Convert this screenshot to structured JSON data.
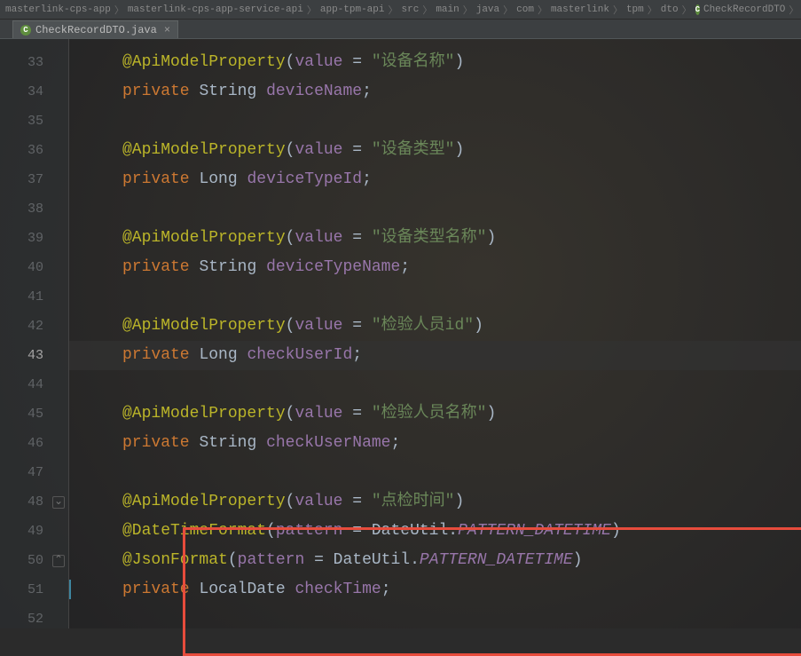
{
  "breadcrumb": {
    "items": [
      "masterlink-cps-app",
      "masterlink-cps-app-service-api",
      "app-tpm-api",
      "src",
      "main",
      "java",
      "com",
      "masterlink",
      "tpm",
      "dto"
    ],
    "class_name": "CheckRecordDTO",
    "field_prefix": "ch"
  },
  "tab": {
    "filename": "CheckRecordDTO.java",
    "close_glyph": "×"
  },
  "gutter": {
    "start": 33,
    "end": 52,
    "current": 43,
    "fold_open_line": 48,
    "fold_close_line": 50
  },
  "tokens": {
    "ann_api": "@ApiModelProperty",
    "ann_dtf": "@DateTimeFormat",
    "ann_json": "@JsonFormat",
    "value": "value",
    "pattern": "pattern",
    "eq": " = ",
    "private": "private",
    "String": "String",
    "Long": "Long",
    "LocalDate": "LocalDate",
    "DateUtil": "DateUtil",
    "PATTERN_DATETIME": "PATTERN_DATETIME",
    "semicolon": ";",
    "lparen": "(",
    "rparen": ")",
    "dot": "."
  },
  "strings": {
    "deviceName": "\"设备名称\"",
    "deviceType": "\"设备类型\"",
    "deviceTypeName": "\"设备类型名称\"",
    "checkUserId": "\"检验人员id\"",
    "checkUserName": "\"检验人员名称\"",
    "checkTime": "\"点检时间\""
  },
  "fields": {
    "deviceName": "deviceName",
    "deviceTypeId": "deviceTypeId",
    "deviceTypeName": "deviceTypeName",
    "checkUserId": "checkUserId",
    "checkUserName": "checkUserName",
    "checkTime": "checkTime"
  }
}
